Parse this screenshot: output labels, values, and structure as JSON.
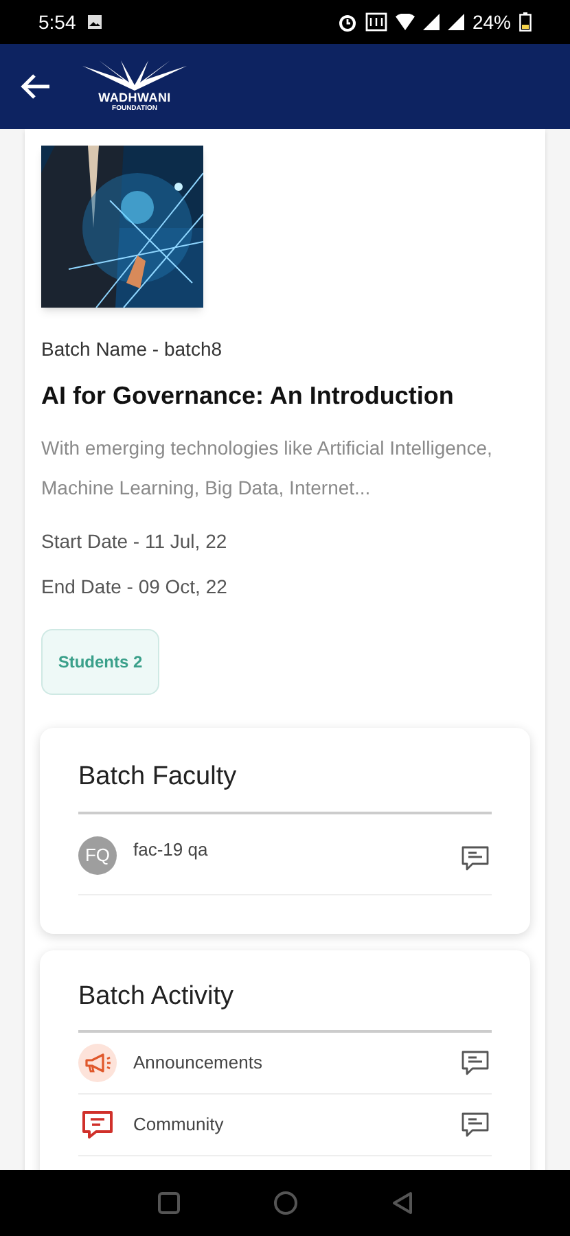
{
  "status_bar": {
    "time": "5:54",
    "battery": "24%"
  },
  "header": {
    "logo_name": "WADHWANI",
    "logo_sub": "FOUNDATION"
  },
  "batch": {
    "name": "Batch Name - batch8",
    "title": "AI for Governance: An Introduction",
    "description": "With emerging technologies like Artificial Intelligence, Machine Learning, Big Data, Internet...",
    "start_date": "Start Date - 11 Jul, 22",
    "end_date": "End Date - 09 Oct, 22",
    "students": "Students 2"
  },
  "faculty": {
    "title": "Batch Faculty",
    "members": [
      {
        "initials": "FQ",
        "name": "fac-19 qa"
      }
    ]
  },
  "activity": {
    "title": "Batch Activity",
    "items": [
      {
        "kind": "announcements",
        "label": "Announcements"
      },
      {
        "kind": "community",
        "label": "Community"
      }
    ]
  }
}
